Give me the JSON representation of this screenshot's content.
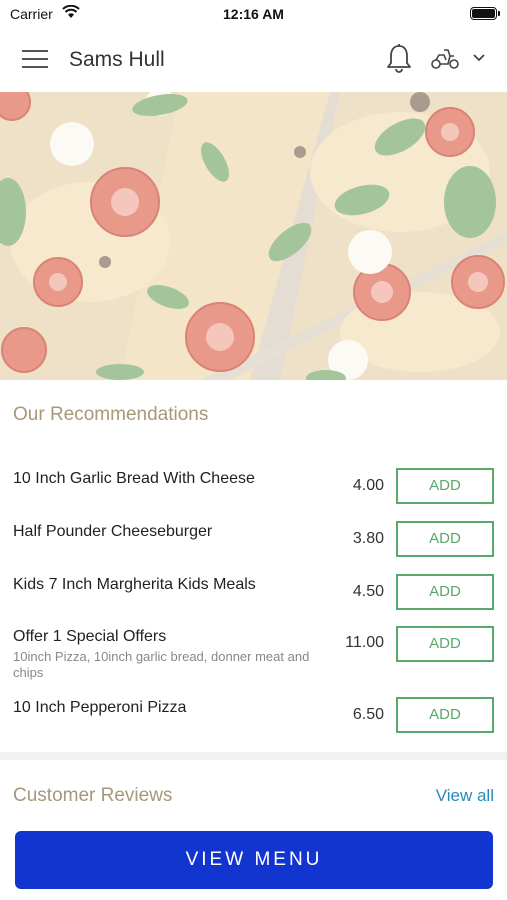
{
  "status_bar": {
    "carrier": "Carrier",
    "time": "12:16 AM"
  },
  "header": {
    "title": "Sams Hull",
    "icons": [
      "menu-icon",
      "bell-icon",
      "scooter-icon",
      "chevron-down-icon"
    ]
  },
  "recommendations": {
    "title": "Our Recommendations",
    "items": [
      {
        "name": "10 Inch Garlic Bread With Cheese",
        "description": "",
        "price": "4.00",
        "button": "ADD"
      },
      {
        "name": "Half Pounder Cheeseburger",
        "description": "",
        "price": "3.80",
        "button": "ADD"
      },
      {
        "name": "Kids 7 Inch Margherita Kids Meals",
        "description": "",
        "price": "4.50",
        "button": "ADD"
      },
      {
        "name": "Offer 1 Special Offers",
        "description": "10inch Pizza, 10inch garlic bread, donner meat and chips",
        "price": "11.00",
        "button": "ADD"
      },
      {
        "name": "10 Inch Pepperoni Pizza",
        "description": "",
        "price": "6.50",
        "button": "ADD"
      }
    ]
  },
  "reviews": {
    "title": "Customer Reviews",
    "view_all": "View all"
  },
  "footer": {
    "view_menu_label": "VIEW MENU"
  },
  "colors": {
    "accent_green": "#5aa86a",
    "primary_blue": "#1235d0",
    "section_title": "#a8977a",
    "link": "#2a8bb6"
  }
}
